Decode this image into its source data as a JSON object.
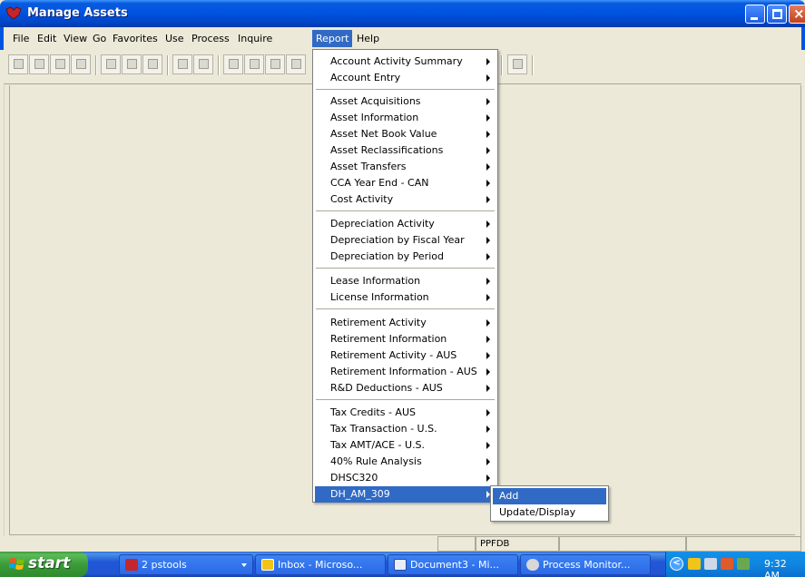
{
  "window": {
    "title": "Manage Assets"
  },
  "menubar": {
    "items": [
      "File",
      "Edit",
      "View",
      "Go",
      "Favorites",
      "Use",
      "Process",
      "Inquire",
      "Report",
      "Help"
    ]
  },
  "report_menu": {
    "groups": [
      [
        "Account Activity Summary",
        "Account Entry"
      ],
      [
        "Asset Acquisitions",
        "Asset Information",
        "Asset Net Book Value",
        "Asset Reclassifications",
        "Asset Transfers",
        "CCA Year End - CAN",
        "Cost Activity"
      ],
      [
        "Depreciation Activity",
        "Depreciation by Fiscal Year",
        "Depreciation by Period"
      ],
      [
        "Lease Information",
        "License Information"
      ],
      [
        "Retirement Activity",
        "Retirement Information",
        "Retirement Activity - AUS",
        "Retirement Information - AUS",
        "R&D Deductions - AUS"
      ],
      [
        "Tax Credits - AUS",
        "Tax Transaction - U.S.",
        "Tax AMT/ACE - U.S.",
        "40% Rule Analysis",
        "DHSC320",
        "DH_AM_309"
      ]
    ],
    "highlighted": "DH_AM_309"
  },
  "submenu": {
    "items": [
      "Add",
      "Update/Display"
    ],
    "highlighted": "Add"
  },
  "statusbar": {
    "database": "PPFDB"
  },
  "taskbar": {
    "start_label": "start",
    "buttons": [
      "2 pstools",
      "Inbox - Microso...",
      "Document3 - Mi...",
      "Process Monitor..."
    ],
    "clock": "9:32 AM"
  },
  "colors": {
    "titlebar": "#0054e3",
    "highlight": "#316ac5",
    "taskbar": "#2157d7",
    "start": "#3a9c38"
  }
}
